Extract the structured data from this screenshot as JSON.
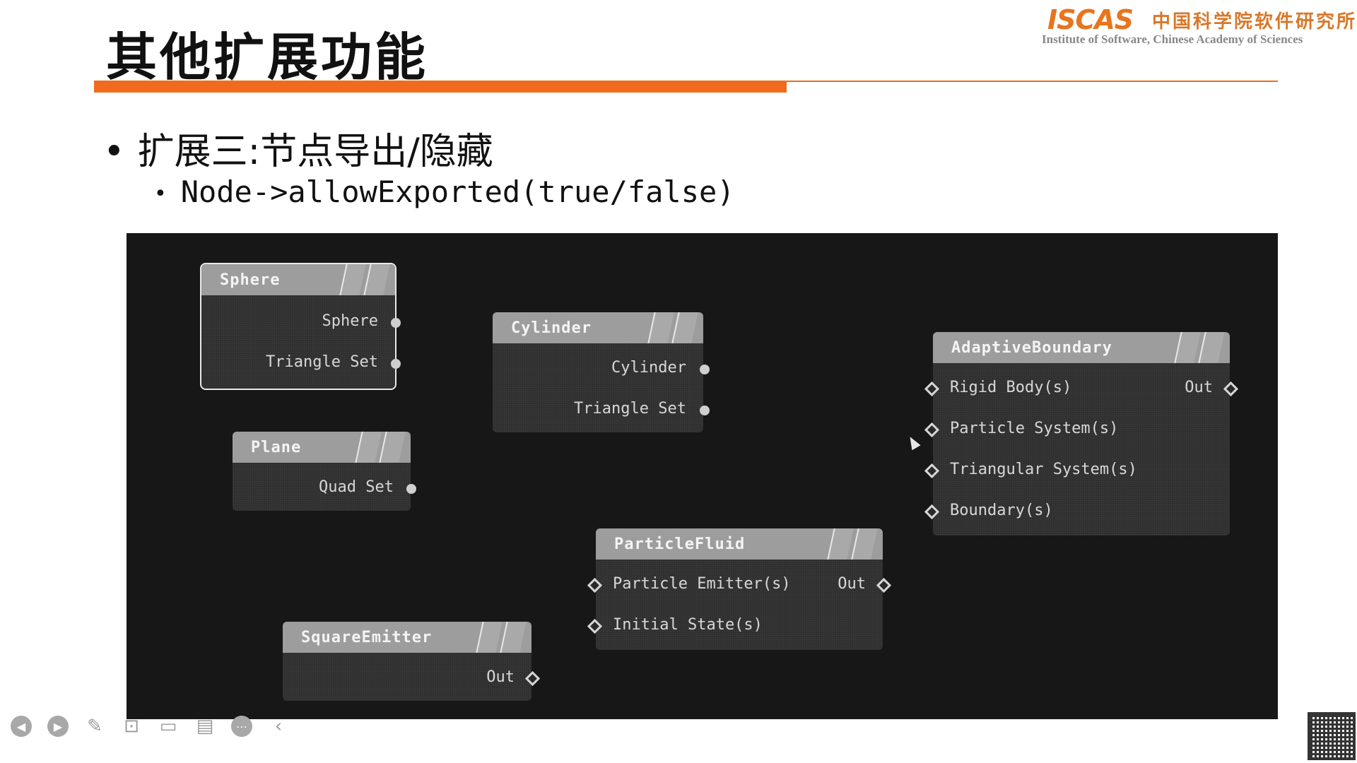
{
  "slide": {
    "title": "其他扩展功能",
    "logo": {
      "mark": "ISCAS",
      "cn": "中国科学院软件研究所",
      "en": "Institute of Software, Chinese Academy of Sciences"
    },
    "bullet1": "扩展三:节点导出/隐藏",
    "bullet2": "Node->allowExported(true/false)",
    "bullet_glyph": "•"
  },
  "nodes": {
    "sphere": {
      "title": "Sphere",
      "outputs": [
        "Sphere",
        "Triangle Set"
      ]
    },
    "cylinder": {
      "title": "Cylinder",
      "outputs": [
        "Cylinder",
        "Triangle Set"
      ]
    },
    "plane": {
      "title": "Plane",
      "outputs": [
        "Quad Set"
      ]
    },
    "adaptive_boundary": {
      "title": "AdaptiveBoundary",
      "inputs": [
        "Rigid Body(s)",
        "Particle System(s)",
        "Triangular System(s)",
        "Boundary(s)"
      ],
      "output": "Out"
    },
    "particle_fluid": {
      "title": "ParticleFluid",
      "inputs": [
        "Particle Emitter(s)",
        "Initial State(s)"
      ],
      "output": "Out"
    },
    "square_emitter": {
      "title": "SquareEmitter",
      "output": "Out"
    }
  },
  "colors": {
    "accent": "#f26a1d",
    "canvas": "#171717",
    "node_header": "#9d9d9d"
  },
  "toolbar_icons": [
    "prev-icon",
    "next-icon",
    "pen-icon",
    "zoom-icon",
    "screen-icon",
    "comment-icon",
    "more-icon",
    "collapse-icon"
  ]
}
